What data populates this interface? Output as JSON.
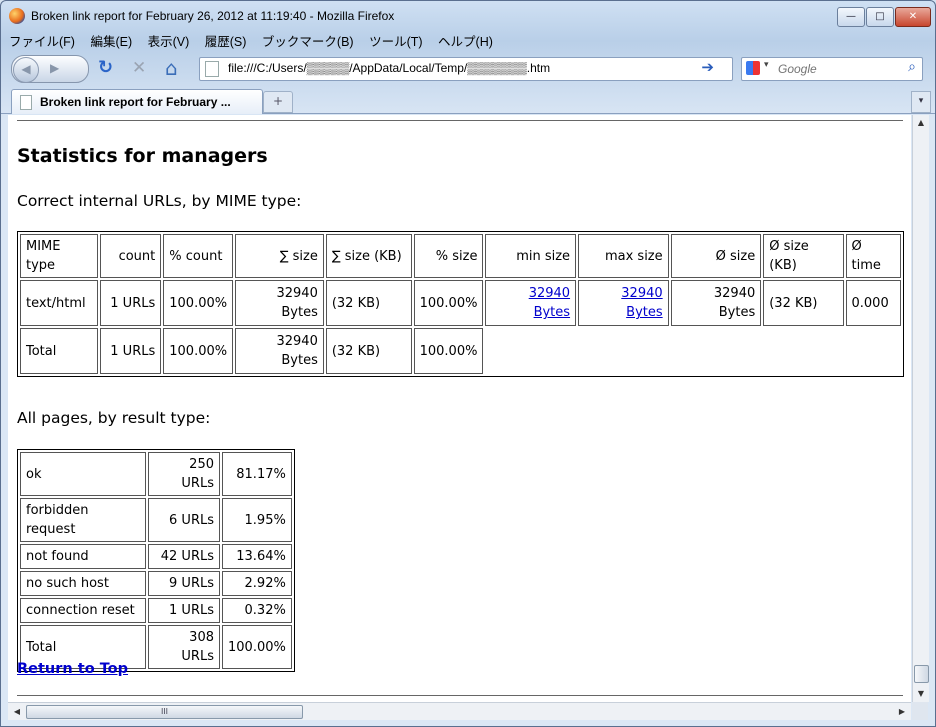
{
  "window": {
    "title": "Broken link report for February 26, 2012 at 11:19:40 - Mozilla Firefox",
    "controls": {
      "minimize": "—",
      "maximize": "□",
      "close": "✕"
    }
  },
  "menu": [
    "ファイル(F)",
    "編集(E)",
    "表示(V)",
    "履歴(S)",
    "ブックマーク(B)",
    "ツール(T)",
    "ヘルプ(H)"
  ],
  "toolbar": {
    "back_icon": "back-arrow-icon",
    "forward_icon": "forward-arrow-icon",
    "reload_glyph": "↻",
    "stop_glyph": "✕",
    "home_glyph": "⌂",
    "url": "file:///C:/Users/▒▒▒▒▒/AppData/Local/Temp/▒▒▒▒▒▒▒.htm",
    "go_glyph": "➔",
    "search_placeholder": "Google",
    "search_glyph": "⌕"
  },
  "tabs": [
    {
      "label": "Broken link report for February ..."
    }
  ],
  "newtab_glyph": "+",
  "tablist_glyph": "▾",
  "page": {
    "heading": "Statistics for managers",
    "section1_title": "Correct internal URLs, by MIME type:",
    "mime_table": {
      "headers": [
        "MIME type",
        "count",
        "% count",
        "∑ size",
        "∑ size (KB)",
        "% size",
        "min size",
        "max size",
        "Ø size",
        "Ø size (KB)",
        "Ø time"
      ],
      "rows": [
        {
          "type": "text/html",
          "count": "1 URLs",
          "pct_count": "100.00%",
          "sum_size": "32940 Bytes",
          "sum_kb": "(32 KB)",
          "pct_size": "100.00%",
          "min_size": "32940 Bytes",
          "max_size": "32940 Bytes",
          "avg_size": "32940 Bytes",
          "avg_kb": "(32 KB)",
          "avg_time": "0.000"
        }
      ],
      "total": {
        "label": "Total",
        "count": "1 URLs",
        "pct_count": "100.00%",
        "sum_size": "32940 Bytes",
        "sum_kb": "(32 KB)",
        "pct_size": "100.00%"
      }
    },
    "section2_title": "All pages, by result type:",
    "result_table": [
      {
        "label": "ok",
        "count": "250 URLs",
        "pct": "81.17%"
      },
      {
        "label": "forbidden request",
        "count": "6 URLs",
        "pct": "1.95%"
      },
      {
        "label": "not found",
        "count": "42 URLs",
        "pct": "13.64%"
      },
      {
        "label": "no such host",
        "count": "9 URLs",
        "pct": "2.92%"
      },
      {
        "label": "connection reset",
        "count": "1 URLs",
        "pct": "0.32%"
      },
      {
        "label": "Total",
        "count": "308 URLs",
        "pct": "100.00%"
      }
    ],
    "return_link": "Return to Top"
  },
  "scrollbars": {
    "up": "▲",
    "down": "▼",
    "left": "◀",
    "right": "▶",
    "grip": "III"
  }
}
